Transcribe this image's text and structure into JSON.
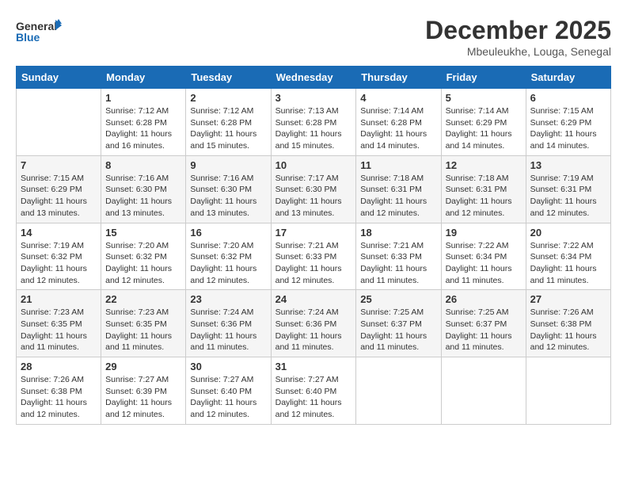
{
  "logo": {
    "general": "General",
    "blue": "Blue"
  },
  "title": {
    "month": "December 2025",
    "location": "Mbeuleukhe, Louga, Senegal"
  },
  "headers": [
    "Sunday",
    "Monday",
    "Tuesday",
    "Wednesday",
    "Thursday",
    "Friday",
    "Saturday"
  ],
  "weeks": [
    [
      {
        "day": "",
        "sunrise": "",
        "sunset": "",
        "daylight": ""
      },
      {
        "day": "1",
        "sunrise": "Sunrise: 7:12 AM",
        "sunset": "Sunset: 6:28 PM",
        "daylight": "Daylight: 11 hours and 16 minutes."
      },
      {
        "day": "2",
        "sunrise": "Sunrise: 7:12 AM",
        "sunset": "Sunset: 6:28 PM",
        "daylight": "Daylight: 11 hours and 15 minutes."
      },
      {
        "day": "3",
        "sunrise": "Sunrise: 7:13 AM",
        "sunset": "Sunset: 6:28 PM",
        "daylight": "Daylight: 11 hours and 15 minutes."
      },
      {
        "day": "4",
        "sunrise": "Sunrise: 7:14 AM",
        "sunset": "Sunset: 6:28 PM",
        "daylight": "Daylight: 11 hours and 14 minutes."
      },
      {
        "day": "5",
        "sunrise": "Sunrise: 7:14 AM",
        "sunset": "Sunset: 6:29 PM",
        "daylight": "Daylight: 11 hours and 14 minutes."
      },
      {
        "day": "6",
        "sunrise": "Sunrise: 7:15 AM",
        "sunset": "Sunset: 6:29 PM",
        "daylight": "Daylight: 11 hours and 14 minutes."
      }
    ],
    [
      {
        "day": "7",
        "sunrise": "Sunrise: 7:15 AM",
        "sunset": "Sunset: 6:29 PM",
        "daylight": "Daylight: 11 hours and 13 minutes."
      },
      {
        "day": "8",
        "sunrise": "Sunrise: 7:16 AM",
        "sunset": "Sunset: 6:30 PM",
        "daylight": "Daylight: 11 hours and 13 minutes."
      },
      {
        "day": "9",
        "sunrise": "Sunrise: 7:16 AM",
        "sunset": "Sunset: 6:30 PM",
        "daylight": "Daylight: 11 hours and 13 minutes."
      },
      {
        "day": "10",
        "sunrise": "Sunrise: 7:17 AM",
        "sunset": "Sunset: 6:30 PM",
        "daylight": "Daylight: 11 hours and 13 minutes."
      },
      {
        "day": "11",
        "sunrise": "Sunrise: 7:18 AM",
        "sunset": "Sunset: 6:31 PM",
        "daylight": "Daylight: 11 hours and 12 minutes."
      },
      {
        "day": "12",
        "sunrise": "Sunrise: 7:18 AM",
        "sunset": "Sunset: 6:31 PM",
        "daylight": "Daylight: 11 hours and 12 minutes."
      },
      {
        "day": "13",
        "sunrise": "Sunrise: 7:19 AM",
        "sunset": "Sunset: 6:31 PM",
        "daylight": "Daylight: 11 hours and 12 minutes."
      }
    ],
    [
      {
        "day": "14",
        "sunrise": "Sunrise: 7:19 AM",
        "sunset": "Sunset: 6:32 PM",
        "daylight": "Daylight: 11 hours and 12 minutes."
      },
      {
        "day": "15",
        "sunrise": "Sunrise: 7:20 AM",
        "sunset": "Sunset: 6:32 PM",
        "daylight": "Daylight: 11 hours and 12 minutes."
      },
      {
        "day": "16",
        "sunrise": "Sunrise: 7:20 AM",
        "sunset": "Sunset: 6:32 PM",
        "daylight": "Daylight: 11 hours and 12 minutes."
      },
      {
        "day": "17",
        "sunrise": "Sunrise: 7:21 AM",
        "sunset": "Sunset: 6:33 PM",
        "daylight": "Daylight: 11 hours and 12 minutes."
      },
      {
        "day": "18",
        "sunrise": "Sunrise: 7:21 AM",
        "sunset": "Sunset: 6:33 PM",
        "daylight": "Daylight: 11 hours and 11 minutes."
      },
      {
        "day": "19",
        "sunrise": "Sunrise: 7:22 AM",
        "sunset": "Sunset: 6:34 PM",
        "daylight": "Daylight: 11 hours and 11 minutes."
      },
      {
        "day": "20",
        "sunrise": "Sunrise: 7:22 AM",
        "sunset": "Sunset: 6:34 PM",
        "daylight": "Daylight: 11 hours and 11 minutes."
      }
    ],
    [
      {
        "day": "21",
        "sunrise": "Sunrise: 7:23 AM",
        "sunset": "Sunset: 6:35 PM",
        "daylight": "Daylight: 11 hours and 11 minutes."
      },
      {
        "day": "22",
        "sunrise": "Sunrise: 7:23 AM",
        "sunset": "Sunset: 6:35 PM",
        "daylight": "Daylight: 11 hours and 11 minutes."
      },
      {
        "day": "23",
        "sunrise": "Sunrise: 7:24 AM",
        "sunset": "Sunset: 6:36 PM",
        "daylight": "Daylight: 11 hours and 11 minutes."
      },
      {
        "day": "24",
        "sunrise": "Sunrise: 7:24 AM",
        "sunset": "Sunset: 6:36 PM",
        "daylight": "Daylight: 11 hours and 11 minutes."
      },
      {
        "day": "25",
        "sunrise": "Sunrise: 7:25 AM",
        "sunset": "Sunset: 6:37 PM",
        "daylight": "Daylight: 11 hours and 11 minutes."
      },
      {
        "day": "26",
        "sunrise": "Sunrise: 7:25 AM",
        "sunset": "Sunset: 6:37 PM",
        "daylight": "Daylight: 11 hours and 11 minutes."
      },
      {
        "day": "27",
        "sunrise": "Sunrise: 7:26 AM",
        "sunset": "Sunset: 6:38 PM",
        "daylight": "Daylight: 11 hours and 12 minutes."
      }
    ],
    [
      {
        "day": "28",
        "sunrise": "Sunrise: 7:26 AM",
        "sunset": "Sunset: 6:38 PM",
        "daylight": "Daylight: 11 hours and 12 minutes."
      },
      {
        "day": "29",
        "sunrise": "Sunrise: 7:27 AM",
        "sunset": "Sunset: 6:39 PM",
        "daylight": "Daylight: 11 hours and 12 minutes."
      },
      {
        "day": "30",
        "sunrise": "Sunrise: 7:27 AM",
        "sunset": "Sunset: 6:40 PM",
        "daylight": "Daylight: 11 hours and 12 minutes."
      },
      {
        "day": "31",
        "sunrise": "Sunrise: 7:27 AM",
        "sunset": "Sunset: 6:40 PM",
        "daylight": "Daylight: 11 hours and 12 minutes."
      },
      {
        "day": "",
        "sunrise": "",
        "sunset": "",
        "daylight": ""
      },
      {
        "day": "",
        "sunrise": "",
        "sunset": "",
        "daylight": ""
      },
      {
        "day": "",
        "sunrise": "",
        "sunset": "",
        "daylight": ""
      }
    ]
  ]
}
